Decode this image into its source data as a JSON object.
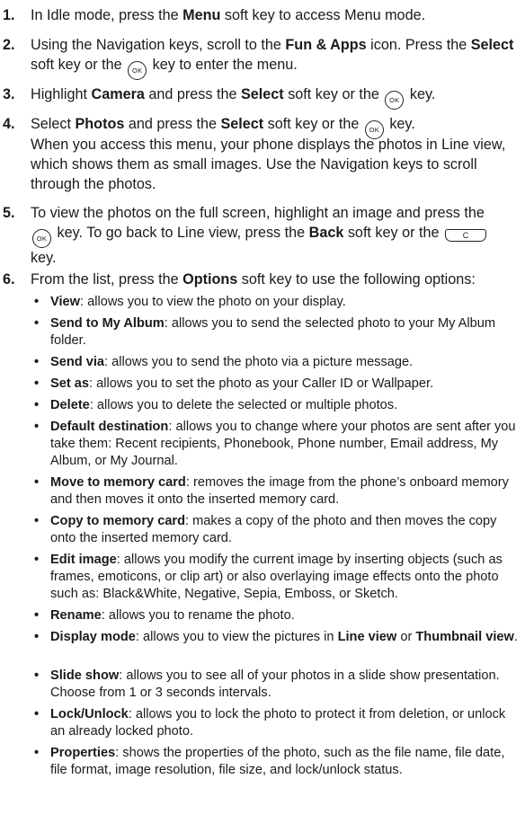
{
  "steps": [
    {
      "num": "1.",
      "parts": [
        "In Idle mode, press the ",
        "Menu",
        " soft key to access Menu mode."
      ]
    },
    {
      "num": "2.",
      "parts": [
        "Using the Navigation keys, scroll to the ",
        "Fun & Apps",
        " icon. Press the ",
        "Select",
        " soft key or the ",
        "key to enter the menu."
      ]
    },
    {
      "num": "3.",
      "parts": [
        "Highlight ",
        "Camera",
        " and press the ",
        "Select",
        " soft key or the ",
        "key."
      ]
    },
    {
      "num": "4.",
      "parts": [
        "Select ",
        "Photos",
        " and press the ",
        "Select",
        " soft key or the ",
        "key."
      ]
    },
    {
      "num": "5.",
      "parts": [
        "To view the photos on the full screen, highlight an image and press the",
        "key. To go back to Line view, press the ",
        "Back",
        " soft key or the",
        "key."
      ]
    },
    {
      "num": "6.",
      "parts": [
        "From the list, press the ",
        "Options",
        " soft key to use the following options:"
      ]
    }
  ],
  "step4_note": "When you access this menu, your phone displays the photos in Line view, which shows them as small images. Use the Navigation keys to scroll through the photos.",
  "keys": {
    "ok": "OK",
    "clear": "C"
  },
  "bullet": "•",
  "options": [
    {
      "name": "View",
      "desc": ": allows you to view the photo on your display."
    },
    {
      "name": "Send to My Album",
      "desc": ": allows you to send the selected photo to your My Album folder."
    },
    {
      "name": "Send via",
      "desc": ": allows you to send the photo via a picture message."
    },
    {
      "name": "Set as",
      "desc": ": allows you to set the photo as your Caller ID or Wallpaper."
    },
    {
      "name": "Delete",
      "desc": ": allows you to delete the selected or multiple photos."
    },
    {
      "name": "Default destination",
      "desc": ": allows you to change where your photos are sent after you take them: Recent recipients, Phonebook, Phone number, Email address, My Album, or My Journal."
    },
    {
      "name": "Move to memory card",
      "desc": ": removes the image from the phone’s onboard memory and then moves it onto the inserted memory card."
    },
    {
      "name": "Copy to memory card",
      "desc": ": makes a copy of the photo and then moves the copy onto the inserted memory card."
    },
    {
      "name": "Edit image",
      "desc": ": allows you modify the current image by inserting objects (such as frames, emoticons, or clip art) or also overlaying image effects onto the photo such as: Black&White, Negative, Sepia, Emboss, or Sketch."
    },
    {
      "name": "Rename",
      "desc": ": allows you to rename the photo."
    },
    {
      "name": "Display mode",
      "desc": ": allows you to view the pictures in ",
      "bold2": "Line view",
      "mid": " or ",
      "bold3": "Thumbnail view",
      "end": "."
    },
    {
      "name": "Slide show",
      "desc": ": allows you to see all of your photos in a slide show presentation. Choose from 1 or 3 seconds intervals."
    },
    {
      "name": "Lock/Unlock",
      "desc": ": allows you to lock the photo to protect it from deletion, or unlock an already locked photo."
    },
    {
      "name": "Properties",
      "desc": ": shows the properties of the photo, such as the file name, file date, file format, image resolution, file size, and lock/unlock status."
    }
  ]
}
